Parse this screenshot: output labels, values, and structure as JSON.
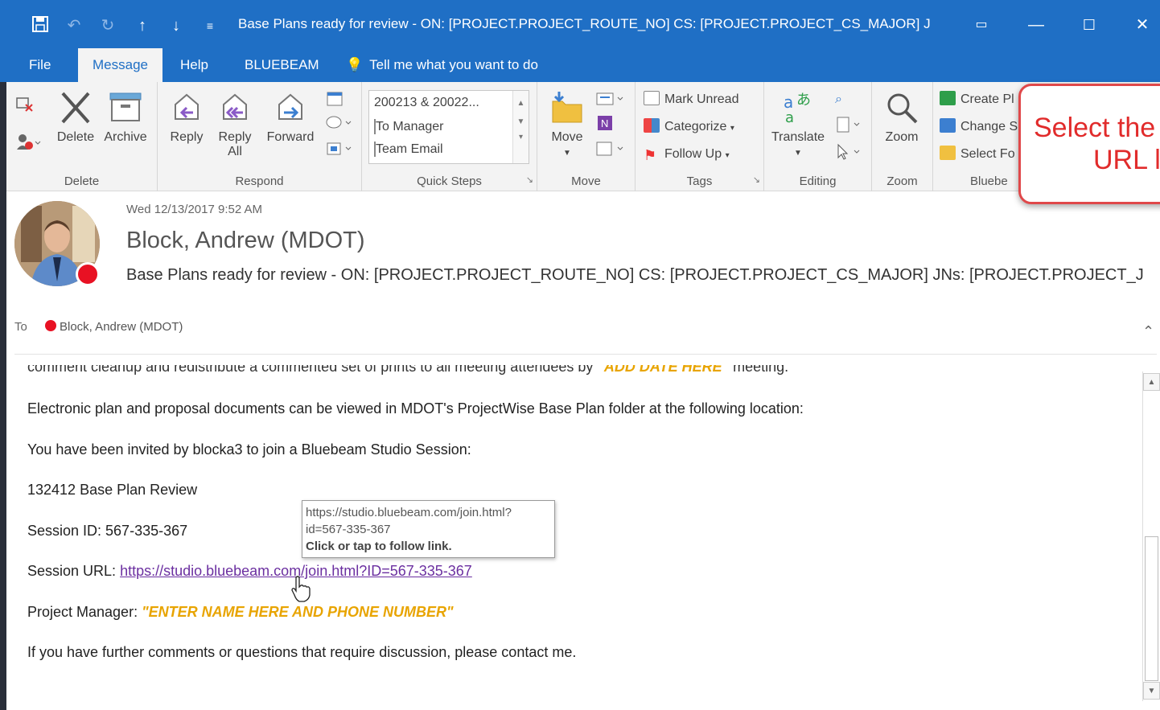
{
  "titlebar": {
    "title": "Base Plans ready for review - ON: [PROJECT.PROJECT_ROUTE_NO] CS: [PROJECT.PROJECT_CS_MAJOR] JNs: [...",
    "color": "#1f6fc5"
  },
  "tabs": [
    {
      "label": "File"
    },
    {
      "label": "Message"
    },
    {
      "label": "Help"
    },
    {
      "label": "BLUEBEAM"
    }
  ],
  "tell_me": "Tell me what you want to do",
  "ribbon": {
    "delete_group": {
      "label": "Delete",
      "delete": "Delete",
      "archive": "Archive"
    },
    "respond_group": {
      "label": "Respond",
      "reply": "Reply",
      "reply_all_1": "Reply",
      "reply_all_2": "All",
      "forward": "Forward"
    },
    "quick_steps": {
      "label": "Quick Steps",
      "items": [
        "200213 & 20022...",
        "To Manager",
        "Team Email"
      ]
    },
    "move_group": {
      "label": "Move",
      "move": "Move"
    },
    "tags_group": {
      "label": "Tags",
      "mark_unread": "Mark Unread",
      "categorize": "Categorize",
      "follow_up": "Follow Up"
    },
    "editing_group": {
      "label": "Editing",
      "translate": "Translate"
    },
    "zoom_group": {
      "label": "Zoom",
      "zoom": "Zoom"
    },
    "bluebeam_group": {
      "label": "Bluebe",
      "create": "Create Pl",
      "change": "Change S",
      "select": "Select Fo"
    }
  },
  "callout": {
    "line1": "Select the",
    "line2": "URL l"
  },
  "message": {
    "date": "Wed 12/13/2017 9:52 AM",
    "sender": "Block, Andrew (MDOT)",
    "subject": "Base Plans ready for review - ON: [PROJECT.PROJECT_ROUTE_NO] CS: [PROJECT.PROJECT_CS_MAJOR] JNs: [PROJECT.PROJECT_J",
    "to_label": "To",
    "to_name": "Block, Andrew (MDOT)"
  },
  "body": {
    "cut_line_a": "comment cleanup and redistribute a commented set of prints to all meeting attendees by ",
    "cut_line_b": "\"ADD DATE HERE\"",
    "cut_line_c": " meeting.",
    "para1": "Electronic plan and proposal documents can be viewed in MDOT's ProjectWise Base Plan folder at the following location:",
    "para2": "You have been invited by blocka3 to join a Bluebeam Studio Session:",
    "para3": "132412 Base Plan Review",
    "session_id": "Session ID: 567-335-367",
    "session_url_label": "Session URL: ",
    "session_url": "https://studio.bluebeam.com/join.html?ID=567-335-367",
    "pm_label": "Project Manager: ",
    "pm_value": "\"ENTER NAME HERE AND PHONE NUMBER\"",
    "closing": "If you have further comments or questions that require discussion, please contact me."
  },
  "tooltip": {
    "line1": "https://studio.bluebeam.com/join.html?",
    "line2": "id=567-335-367",
    "line3": "Click or tap to follow link."
  },
  "colors": {
    "accent": "#1f6fc5",
    "presence": "#e81123",
    "link": "#6b2fa0",
    "placeholder": "#e8a400",
    "callout": "#e12b2b"
  }
}
